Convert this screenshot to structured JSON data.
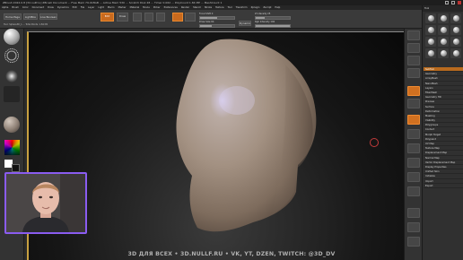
{
  "titlebar": {
    "text": "ZBrush 2022.0.8 [3d.nullf.ru] ZBrush Document ... Free Mem 79.018GB ... Active Mem 530 ... Scratch Disk 48 ... Timer 0.062 ... PolyCount 1.84 MP ... MeshCount 1"
  },
  "menus": [
    "Alpha",
    "Brush",
    "Color",
    "Document",
    "Draw",
    "Dynamics",
    "Edit",
    "File",
    "Layer",
    "Light",
    "Macro",
    "Marker",
    "Material",
    "Movie",
    "Picker",
    "Preferences",
    "Render",
    "Stencil",
    "Stroke",
    "Texture",
    "Tool",
    "Transform",
    "Zplugin",
    "Zscript",
    "Help"
  ],
  "toolbar": {
    "buttons": [
      "Home Page",
      "LightBox",
      "Live Boolean"
    ],
    "edit_label": "Edit",
    "draw_label": "Draw",
    "focal_shift_label": "Focal Shift 0",
    "draw_size_label": "Draw Size 64",
    "dynamic_label": "Dynamic",
    "z_intensity_label": "Z Intensity 25",
    "rgb_intensity_label": "Rgb Intensity 100",
    "hint": "Tool: Sphere3D_1  ...  Total Points: 1.84 Mil"
  },
  "palette": {
    "header": "Tool",
    "items": [
      "SubTool",
      "Geometry",
      "ArrayMesh",
      "NanoMesh",
      "Layers",
      "FiberMesh",
      "Geometry HD",
      "Preview",
      "Surface",
      "Deformation",
      "Masking",
      "Visibility",
      "Polygroups",
      "Contact",
      "Morph Target",
      "Polypaint",
      "UV Map",
      "Texture Map",
      "Displacement Map",
      "Normal Map",
      "Vector Displacement Map",
      "Display Properties",
      "Unified Skin",
      "Initialize",
      "Import",
      "Export"
    ],
    "active_index": 0
  },
  "colors": {
    "accent": "#c96a1e",
    "webcam_border": "#8a5cf0",
    "viewport_frame": "#c8a040"
  },
  "banner": {
    "text": "3D ДЛЯ ВСЕХ • 3D.NULLF.RU • VK, YT, DZEN, TWITCH: @3D_DV"
  }
}
